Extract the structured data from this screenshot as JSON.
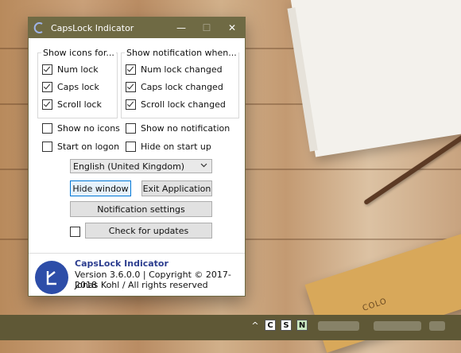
{
  "window": {
    "title": "CapsLock Indicator",
    "controls": {
      "minimize": "—",
      "maximize": "☐",
      "close": "✕"
    }
  },
  "icons_group": {
    "title": "Show icons for...",
    "items": [
      {
        "label": "Num lock",
        "checked": true
      },
      {
        "label": "Caps lock",
        "checked": true
      },
      {
        "label": "Scroll lock",
        "checked": true
      }
    ]
  },
  "notify_group": {
    "title": "Show notification when...",
    "items": [
      {
        "label": "Num lock changed",
        "checked": true
      },
      {
        "label": "Caps lock changed",
        "checked": true
      },
      {
        "label": "Scroll lock changed",
        "checked": true
      }
    ]
  },
  "options": {
    "show_no_icons": "Show no icons",
    "show_no_notification": "Show no notification",
    "start_on_logon": "Start on logon",
    "hide_on_start_up": "Hide on start up"
  },
  "language": {
    "selected": "English (United Kingdom)"
  },
  "buttons": {
    "hide_window": "Hide window",
    "exit_application": "Exit Application",
    "notification_settings": "Notification settings",
    "check_for_updates": "Check for updates"
  },
  "footer": {
    "app_name": "CapsLock Indicator",
    "version_line": "Version 3.6.0.0 | Copyright © 2017-2018",
    "author_line": "Jonas Kohl / All rights reserved"
  },
  "taskbar": {
    "show_hidden": "^",
    "keys": [
      "C",
      "S",
      "N"
    ]
  },
  "background": {
    "book_text": "COLO"
  },
  "colors": {
    "titlebar": "#6f6a44",
    "accent": "#0078d7",
    "logo": "#2d4da8",
    "taskbar": "#5f5836"
  }
}
